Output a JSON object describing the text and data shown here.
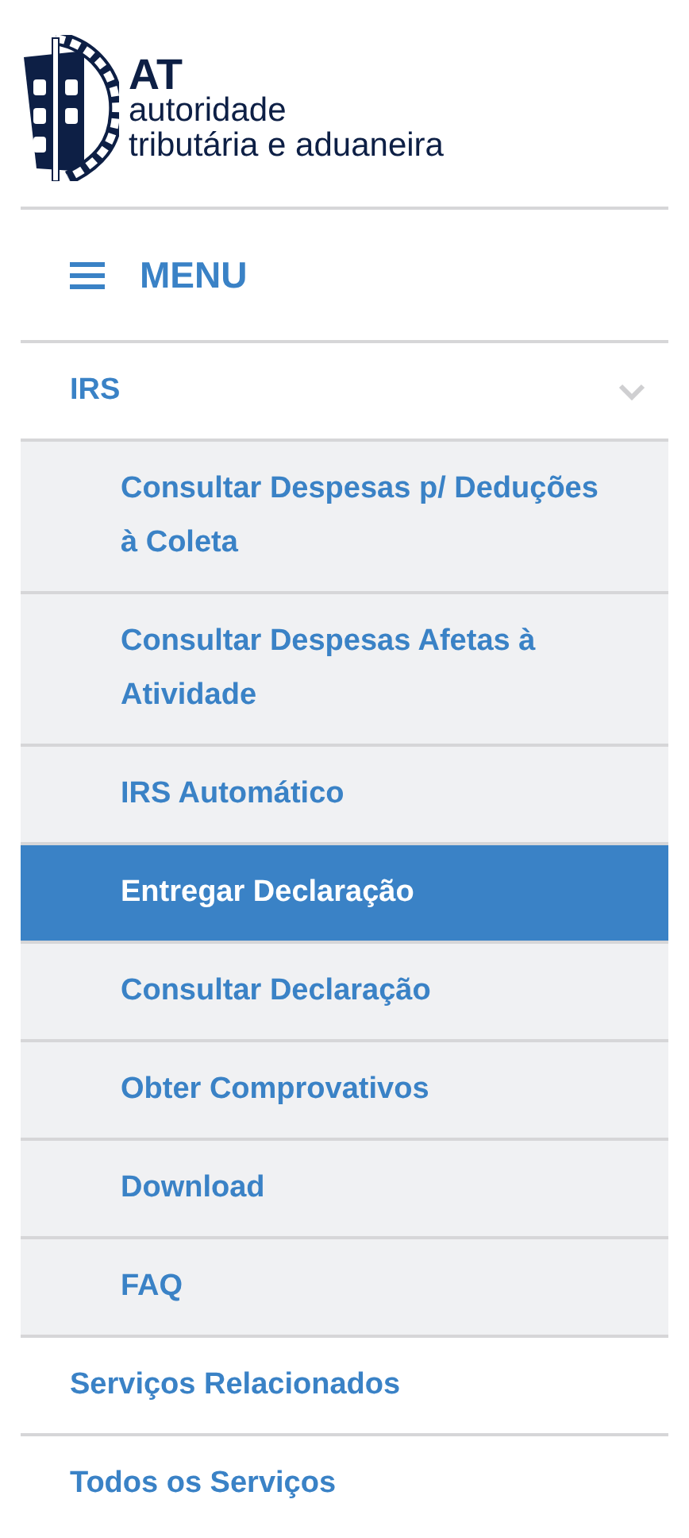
{
  "logo": {
    "acronym": "AT",
    "line_1": "autoridade",
    "line_2": "tributária e aduaneira"
  },
  "menu_button": {
    "label": "MENU"
  },
  "sections": [
    {
      "label": "IRS",
      "expanded": true,
      "children": [
        {
          "label": "Consultar Despesas p/ Deduções à Coleta",
          "selected": false
        },
        {
          "label": "Consultar Despesas Afetas à Atividade",
          "selected": false
        },
        {
          "label": "IRS Automático",
          "selected": false
        },
        {
          "label": "Entregar Declaração",
          "selected": true
        },
        {
          "label": "Consultar Declaração",
          "selected": false
        },
        {
          "label": "Obter Comprovativos",
          "selected": false
        },
        {
          "label": "Download",
          "selected": false
        },
        {
          "label": "FAQ",
          "selected": false
        }
      ]
    },
    {
      "label": "Serviços Relacionados"
    },
    {
      "label": "Todos os Serviços"
    }
  ]
}
